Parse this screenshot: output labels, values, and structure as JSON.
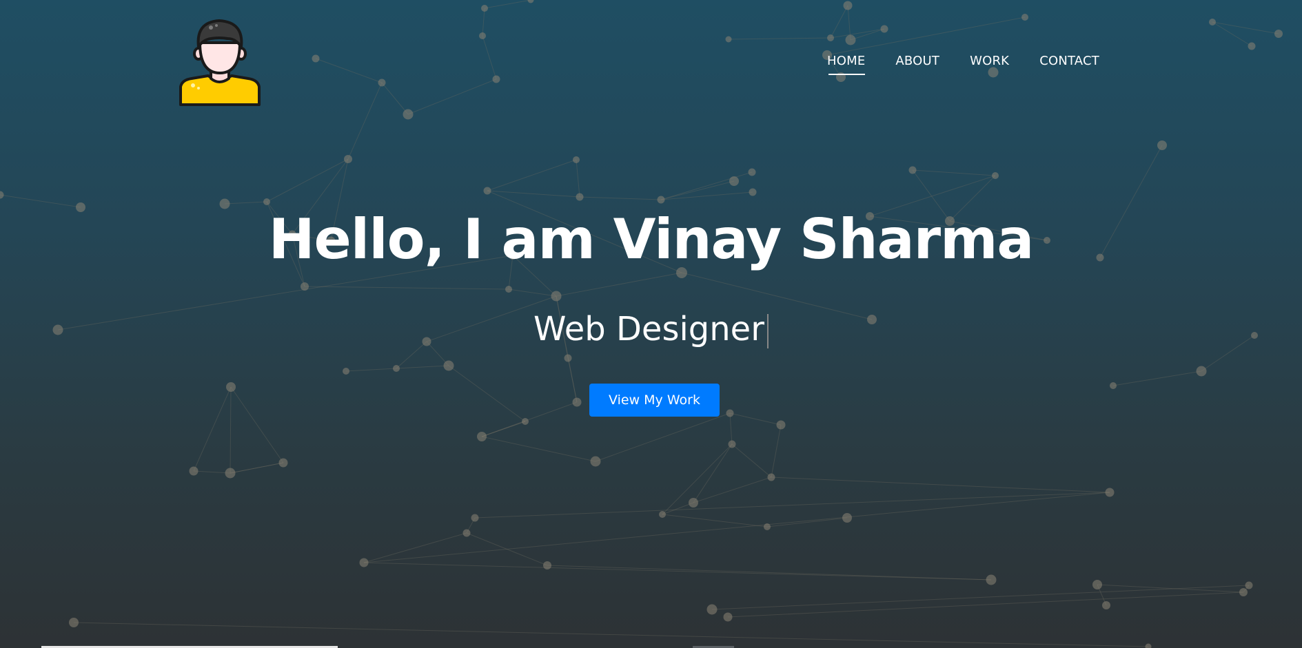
{
  "header": {
    "logo_icon": "avatar-icon",
    "nav": {
      "home": "HOME",
      "about": "ABOUT",
      "work": "WORK",
      "contact": "CONTACT"
    },
    "active_nav": "HOME"
  },
  "hero": {
    "title": "Hello, I am Vinay Sharma",
    "subtitle": "Web Designer",
    "cta_label": "View My Work"
  },
  "colors": {
    "accent": "#007bff",
    "background_top": "#1f4e63",
    "background_bottom": "#2d3235",
    "particle": "#8a8474"
  }
}
